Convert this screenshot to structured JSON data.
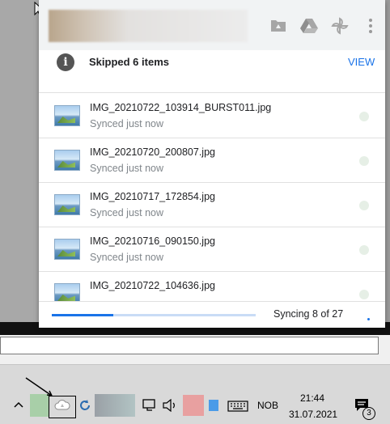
{
  "popup": {
    "notice": {
      "text": "Skipped 6 items",
      "action": "VIEW"
    },
    "files": [
      {
        "name": "IMG_20210722_103914_BURST011.jpg",
        "status": "Synced just now"
      },
      {
        "name": "IMG_20210720_200807.jpg",
        "status": "Synced just now"
      },
      {
        "name": "IMG_20210717_172854.jpg",
        "status": "Synced just now"
      },
      {
        "name": "IMG_20210716_090150.jpg",
        "status": "Synced just now"
      },
      {
        "name": "IMG_20210722_104636.jpg",
        "status": ""
      }
    ],
    "footer": {
      "sync_text": "Syncing 8 of 27",
      "progress": 0.3
    }
  },
  "taskbar": {
    "language": "NOB",
    "time": "21:44",
    "date": "31.07.2021",
    "notification_count": "3"
  },
  "icons": {
    "header": [
      "folder-icon",
      "drive-icon",
      "photos-icon",
      "more-vert-icon"
    ],
    "tray": [
      "chevron-up-icon",
      "drive-sync-icon",
      "sync-icon",
      "network-icon",
      "volume-icon",
      "keyboard-icon",
      "notification-icon"
    ]
  },
  "colors": {
    "accent": "#1a73e8",
    "header_bg": "#f1f3f4"
  }
}
